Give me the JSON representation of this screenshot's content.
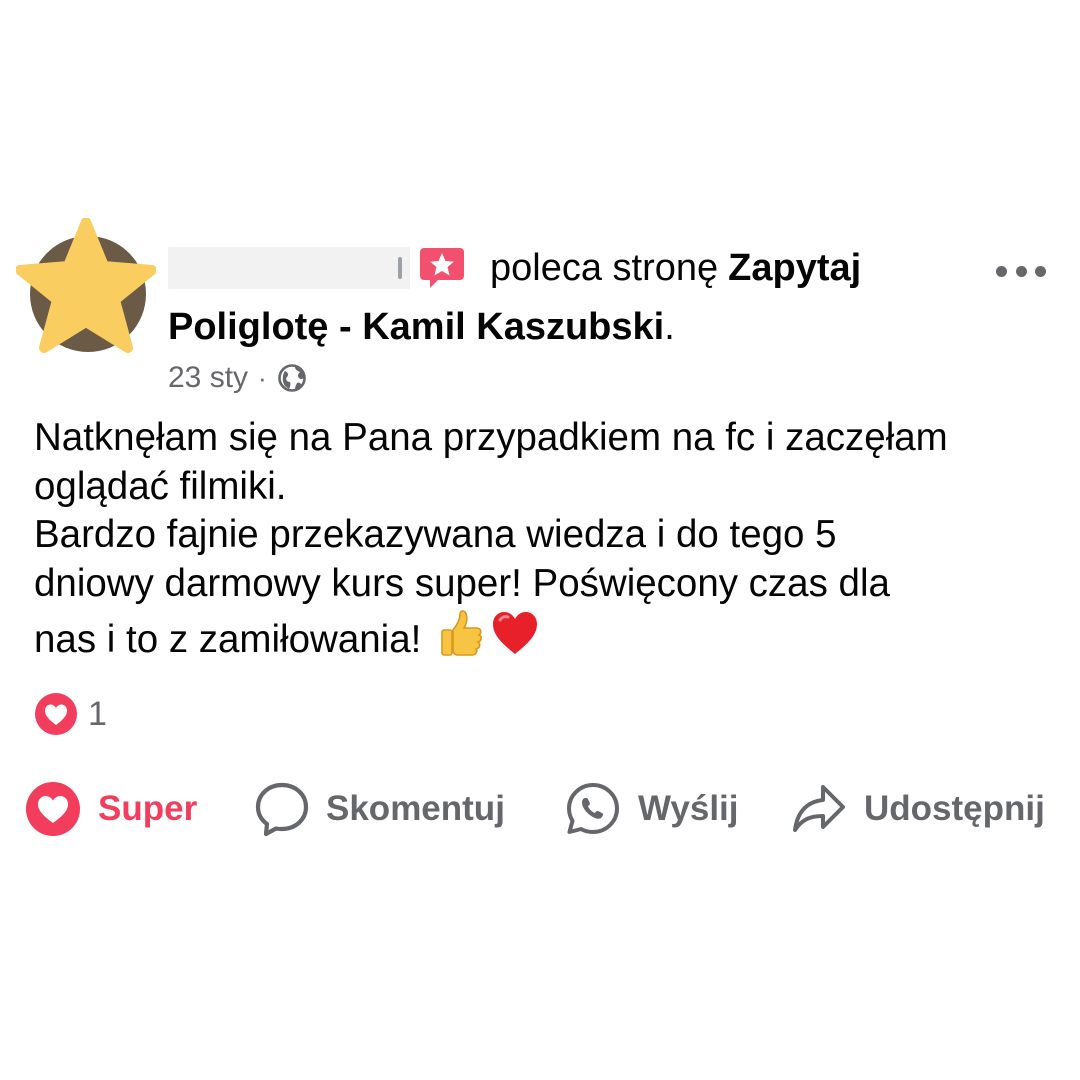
{
  "post": {
    "author": {
      "avatar_icon": "star-redaction",
      "name_redacted": true
    },
    "recommend_icon": "recommend-star-icon",
    "verb": "poleca stronę",
    "page_name_line1": "Zapytaj",
    "page_name_line2": "Poliglotę - Kamil Kaszubski",
    "page_name_suffix": ".",
    "timestamp": "23 sty",
    "separator": "·",
    "privacy_icon": "globe-icon",
    "more_icon": "more-options-icon",
    "body_lines": [
      "Natknęłam się na Pana przypadkiem na fc i zaczęłam",
      "oglądać filmiki.",
      "Bardzo fajnie przekazywana wiedza i do tego 5",
      "dniowy darmowy kurs super!  Poświęcony czas dla",
      "nas i to z zamiłowania! "
    ],
    "body_emojis": [
      "thumbs-up-emoji",
      "red-heart-emoji"
    ],
    "reactions": {
      "icon": "love-reaction-icon",
      "count": "1"
    },
    "actions": {
      "like_label": "Super",
      "comment_label": "Skomentuj",
      "send_label": "Wyślij",
      "share_label": "Udostępnij"
    },
    "colors": {
      "love_accent": "#f23e5c",
      "secondary_text": "#65676b",
      "star": "#f9cd5f",
      "recommend_badge": "#f2506e"
    }
  }
}
